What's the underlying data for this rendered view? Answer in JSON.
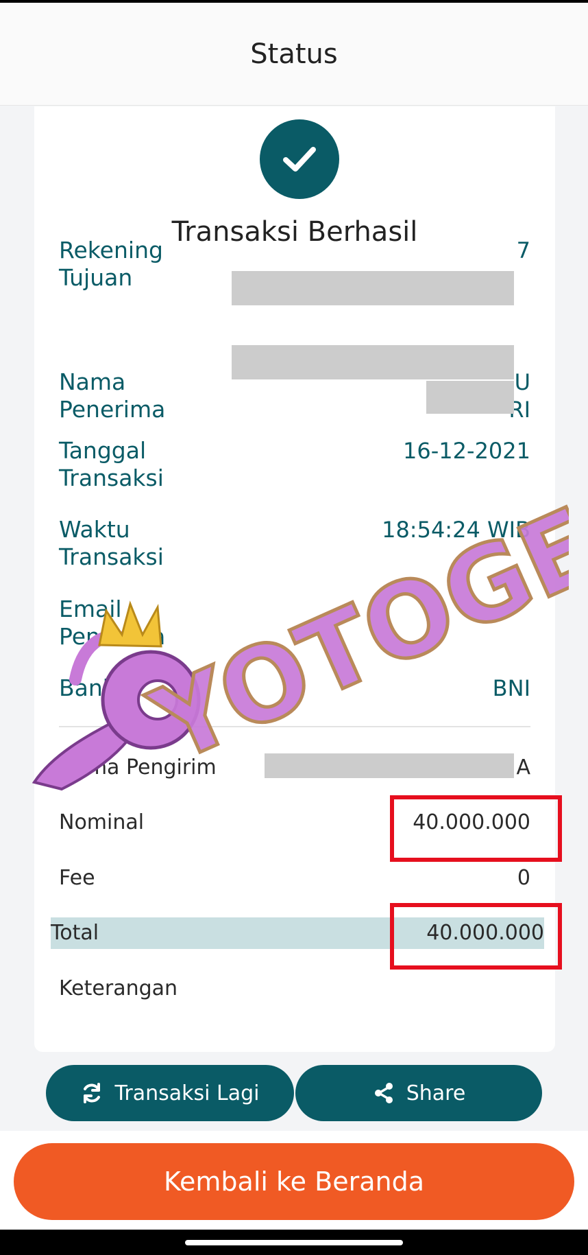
{
  "header": {
    "title": "Status"
  },
  "status": {
    "title": "Transaksi Berhasil"
  },
  "details": {
    "rekening_label": "Rekening Tujuan",
    "rekening_value_tail": "7",
    "nama_label": "Nama Penerima",
    "nama_value_line1_tail": "U",
    "nama_value_line2_tail": "RI",
    "tanggal_label": "Tanggal Transaksi",
    "tanggal_value": "16-12-2021",
    "waktu_label": "Waktu Transaksi",
    "waktu_value": "18:54:24 WIB",
    "email_label": "Email Penerima",
    "email_value": "",
    "bank_label": "Bank Tujuan",
    "bank_value": "BNI"
  },
  "summary": {
    "pengirim_label": "Nama Pengirim",
    "pengirim_value_tail": "A",
    "nominal_label": "Nominal",
    "nominal_value": "40.000.000",
    "fee_label": "Fee",
    "fee_value": "0",
    "total_label": "Total",
    "total_value": "40.000.000",
    "keterangan_label": "Keterangan"
  },
  "buttons": {
    "again_label": "Transaksi Lagi",
    "share_label": "Share",
    "home_label": "Kembali ke Beranda"
  },
  "watermark": {
    "text": "YOTOGEL"
  },
  "colors": {
    "primary": "#0a5b66",
    "accent": "#f05a24",
    "highlight": "#e60f1e",
    "total_bg": "#c9dfe1"
  },
  "icons": {
    "success": "check-icon",
    "again": "refresh-icon",
    "share": "share-icon"
  }
}
